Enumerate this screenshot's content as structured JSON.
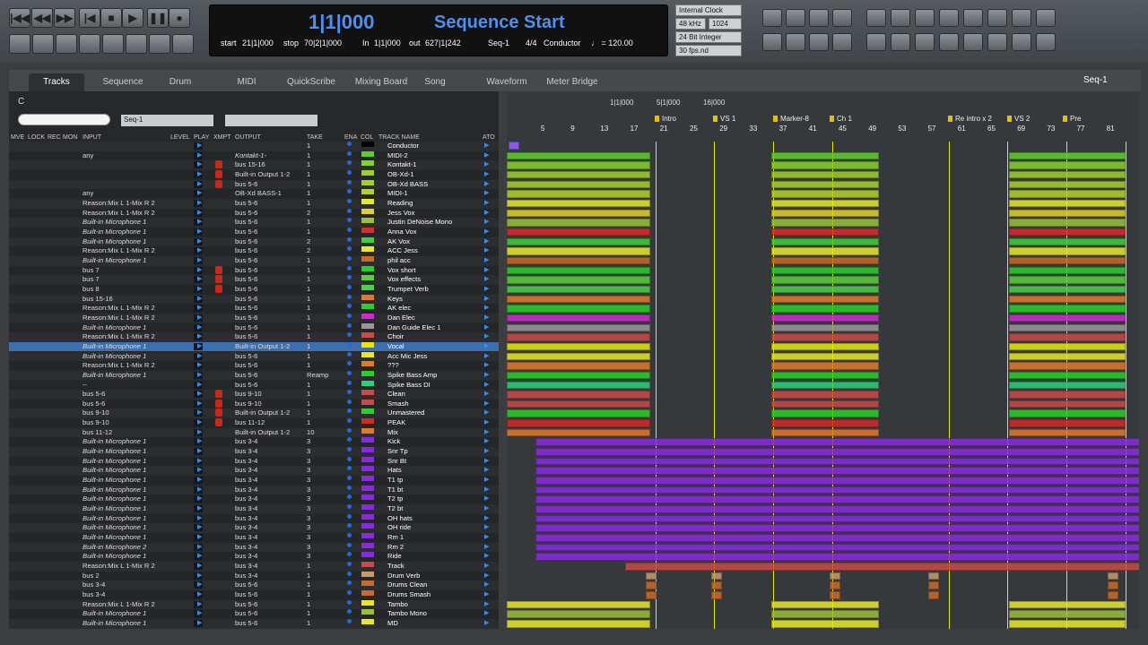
{
  "transport": {
    "buttons": [
      "|◀◀",
      "◀◀",
      "▶▶",
      "|◀",
      "■",
      "▶",
      "❚❚",
      "●"
    ]
  },
  "counter": {
    "main": "1|1|000",
    "title": "Sequence Start",
    "start_label": "start",
    "start_val": "21|1|000",
    "stop_label": "stop",
    "stop_val": "70|2|1|000",
    "in_label": "In",
    "in_val": "1|1|000",
    "out_label": "out",
    "out_val": "627|1|242",
    "seq": "Seq-1",
    "meter": "4/4",
    "conductor": "Conductor",
    "tempo": "♩ = 120.00"
  },
  "settings": {
    "clock": "Internal Clock",
    "rate": "48 kHz",
    "buffer": "1024",
    "bits": "24 Bit Integer",
    "fps": "30 fps.nd"
  },
  "tabs": [
    "Tracks",
    "Sequence",
    "Drum",
    "MIDI",
    "QuickScribe",
    "Mixing Board",
    "Song",
    "Waveform",
    "Meter Bridge"
  ],
  "seq_menu": "Seq-1",
  "tracklist": {
    "title": "C",
    "search_placeholder": "",
    "seq_filter": "Seq-1",
    "headers": [
      "MVE",
      "LOCK",
      "REC",
      "MON",
      "INPUT",
      "LEVEL",
      "PLAY",
      "XMPT",
      "OUTPUT",
      "TAKE",
      "ENA",
      "COL",
      "TRACK NAME",
      "ATO"
    ]
  },
  "tracks": [
    [
      "",
      "",
      "1",
      "",
      "Conductor",
      "#000000"
    ],
    [
      "any",
      "Kontakt-1-",
      "1",
      "",
      "MIDI-2",
      "#5fd02a"
    ],
    [
      "",
      "bus 15-16",
      "1",
      "",
      "Kontakt-1",
      "#86d12b"
    ],
    [
      "",
      "Built-in Output 1-2",
      "1",
      "",
      "OB-Xd-1",
      "#9bd12b"
    ],
    [
      "",
      "bus 5-6",
      "1",
      "",
      "OB-Xd BASS",
      "#a6d12b"
    ],
    [
      "any",
      "OB-Xd BASS-1",
      "1",
      "",
      "MIDI-1",
      "#b5d02a"
    ],
    [
      "Reason:Mix L 1-Mix R 2",
      "bus 5-6",
      "1",
      "",
      "Reading",
      "#e8e82a"
    ],
    [
      "Reason:Mix L 1-Mix R 2",
      "bus 5-6",
      "2",
      "",
      "Jess Vox",
      "#e1d22b"
    ],
    [
      "Built-in Microphone 1",
      "bus 5-6",
      "1",
      "",
      "Justin DeNoise Mono",
      "#9ac03a"
    ],
    [
      "Built-in Microphone 1",
      "bus 5-6",
      "1",
      "",
      "Anna Vox",
      "#e02a2a"
    ],
    [
      "Built-in Microphone 1",
      "bus 5-6",
      "2",
      "",
      "AK Vox",
      "#3fd03a"
    ],
    [
      "Reason:Mix L 1-Mix R 2",
      "bus 5-6",
      "2",
      "",
      "ACC Jess",
      "#e8e82a"
    ],
    [
      "Built-in Microphone 1",
      "bus 5-6",
      "1",
      "",
      "phil acc",
      "#c86a2a"
    ],
    [
      "bus 7",
      "bus 5-6",
      "1",
      "",
      "Vox short",
      "#2ad02a"
    ],
    [
      "bus 7",
      "bus 5-6",
      "1",
      "",
      "Vox effects",
      "#5ad03a"
    ],
    [
      "bus 8",
      "bus 5-6",
      "1",
      "",
      "Trumpet Verb",
      "#4bd04a"
    ],
    [
      "bus 15-16",
      "bus 5-6",
      "1",
      "",
      "Keys",
      "#e07a2a"
    ],
    [
      "Reason:Mix L 1-Mix R 2",
      "bus 5-6",
      "1",
      "",
      "AK elec",
      "#2ad02a"
    ],
    [
      "Reason:Mix L 1-Mix R 2",
      "bus 5-6",
      "1",
      "",
      "Dan Elec",
      "#d02ad0"
    ],
    [
      "Built-in Microphone 1",
      "bus 5-6",
      "1",
      "",
      "Dan Guide Elec 1",
      "#999999"
    ],
    [
      "Reason:Mix L 1-Mix R 2",
      "bus 5-6",
      "1",
      "",
      "Choir",
      "#c84a4a"
    ],
    [
      "Built-in Microphone 1",
      "Built-in Output 1-2",
      "1",
      "",
      "Vocal",
      "#e8e800"
    ],
    [
      "Built-in Microphone 1",
      "bus 5-6",
      "1",
      "",
      "Acc Mic Jess",
      "#e8e82a"
    ],
    [
      "Reason:Mix L 1-Mix R 2",
      "bus 5-6",
      "1",
      "",
      "???",
      "#e07a2a"
    ],
    [
      "Built-in Microphone 1",
      "bus 5-6",
      "Reamp",
      "",
      "Spike Bass Amp",
      "#2ad02a"
    ],
    [
      "--",
      "bus 5-6",
      "1",
      "",
      "Spike Bass DI",
      "#2ad07a"
    ],
    [
      "bus 5-6",
      "bus 9-10",
      "1",
      "",
      "Clean",
      "#c84a4a"
    ],
    [
      "bus 5-6",
      "bus 9-10",
      "1",
      "",
      "Smash",
      "#c84a4a"
    ],
    [
      "bus 9-10",
      "Built-in Output 1-2",
      "1",
      "",
      "Unmastered",
      "#2ad02a"
    ],
    [
      "bus 9-10",
      "bus 11-12",
      "1",
      "",
      "PEAK",
      "#d02a2a"
    ],
    [
      "bus 11-12",
      "Built-in Output 1-2",
      "10",
      "",
      "Mix",
      "#e07a2a"
    ],
    [
      "Built-in Microphone 1",
      "bus 3-4",
      "3",
      "",
      "Kick",
      "#8a2ae0"
    ],
    [
      "Built-in Microphone 1",
      "bus 3-4",
      "3",
      "",
      "Snr Tp",
      "#8a2ae0"
    ],
    [
      "Built-in Microphone 1",
      "bus 3-4",
      "3",
      "",
      "Snr Bt",
      "#8a2ae0"
    ],
    [
      "Built-in Microphone 1",
      "bus 3-4",
      "3",
      "",
      "Hats",
      "#8a2ae0"
    ],
    [
      "Built-in Microphone 1",
      "bus 3-4",
      "3",
      "",
      "T1 tp",
      "#8a2ae0"
    ],
    [
      "Built-in Microphone 1",
      "bus 3-4",
      "3",
      "",
      "T1 bt",
      "#8a2ae0"
    ],
    [
      "Built-in Microphone 1",
      "bus 3-4",
      "3",
      "",
      "T2 tp",
      "#8a2ae0"
    ],
    [
      "Built-in Microphone 1",
      "bus 3-4",
      "3",
      "",
      "T2 bt",
      "#8a2ae0"
    ],
    [
      "Built-in Microphone 1",
      "bus 3-4",
      "3",
      "",
      "OH hats",
      "#8a2ae0"
    ],
    [
      "Built-in Microphone 1",
      "bus 3-4",
      "3",
      "",
      "OH ride",
      "#8a2ae0"
    ],
    [
      "Built-in Microphone 1",
      "bus 3-4",
      "3",
      "",
      "Rm 1",
      "#8a2ae0"
    ],
    [
      "Built-in Microphone 2",
      "bus 3-4",
      "3",
      "",
      "Rm 2",
      "#8a2ae0"
    ],
    [
      "Built-in Microphone 1",
      "bus 3-4",
      "3",
      "",
      "Ride",
      "#8a2ae0"
    ],
    [
      "Reason:Mix L 1-Mix R 2",
      "bus 3-4",
      "1",
      "",
      "Track",
      "#c84a4a"
    ],
    [
      "bus 2",
      "bus 3-4",
      "1",
      "",
      "Drum Verb",
      "#c89a6a"
    ],
    [
      "bus 3-4",
      "bus 5-6",
      "1",
      "",
      "Drums Clean",
      "#c86a2a"
    ],
    [
      "bus 3-4",
      "bus 5-6",
      "1",
      "",
      "Drums Smash",
      "#c86a2a"
    ],
    [
      "Reason:Mix L 1-Mix R 2",
      "bus 5-6",
      "1",
      "",
      "Tambo",
      "#e8e82a"
    ],
    [
      "Built-in Microphone 1",
      "bus 5-6",
      "1",
      "",
      "Tambo Mono",
      "#9ac03a"
    ],
    [
      "Built-in Microphone 1",
      "bus 5-6",
      "1",
      "",
      "MD",
      "#e8e82a"
    ]
  ],
  "timeline": {
    "locs": [
      "1|1|000",
      "5|1|000",
      "16|000"
    ],
    "bars": [
      "5",
      "9",
      "13",
      "17",
      "21",
      "25",
      "29",
      "33",
      "37",
      "41",
      "45",
      "49",
      "53",
      "57",
      "61",
      "65",
      "69",
      "73",
      "77",
      "81"
    ],
    "markers": [
      "Intro",
      "VS 1",
      "Marker-8",
      "Ch 1",
      "Re intro x 2",
      "VS 2",
      "Pre"
    ]
  }
}
